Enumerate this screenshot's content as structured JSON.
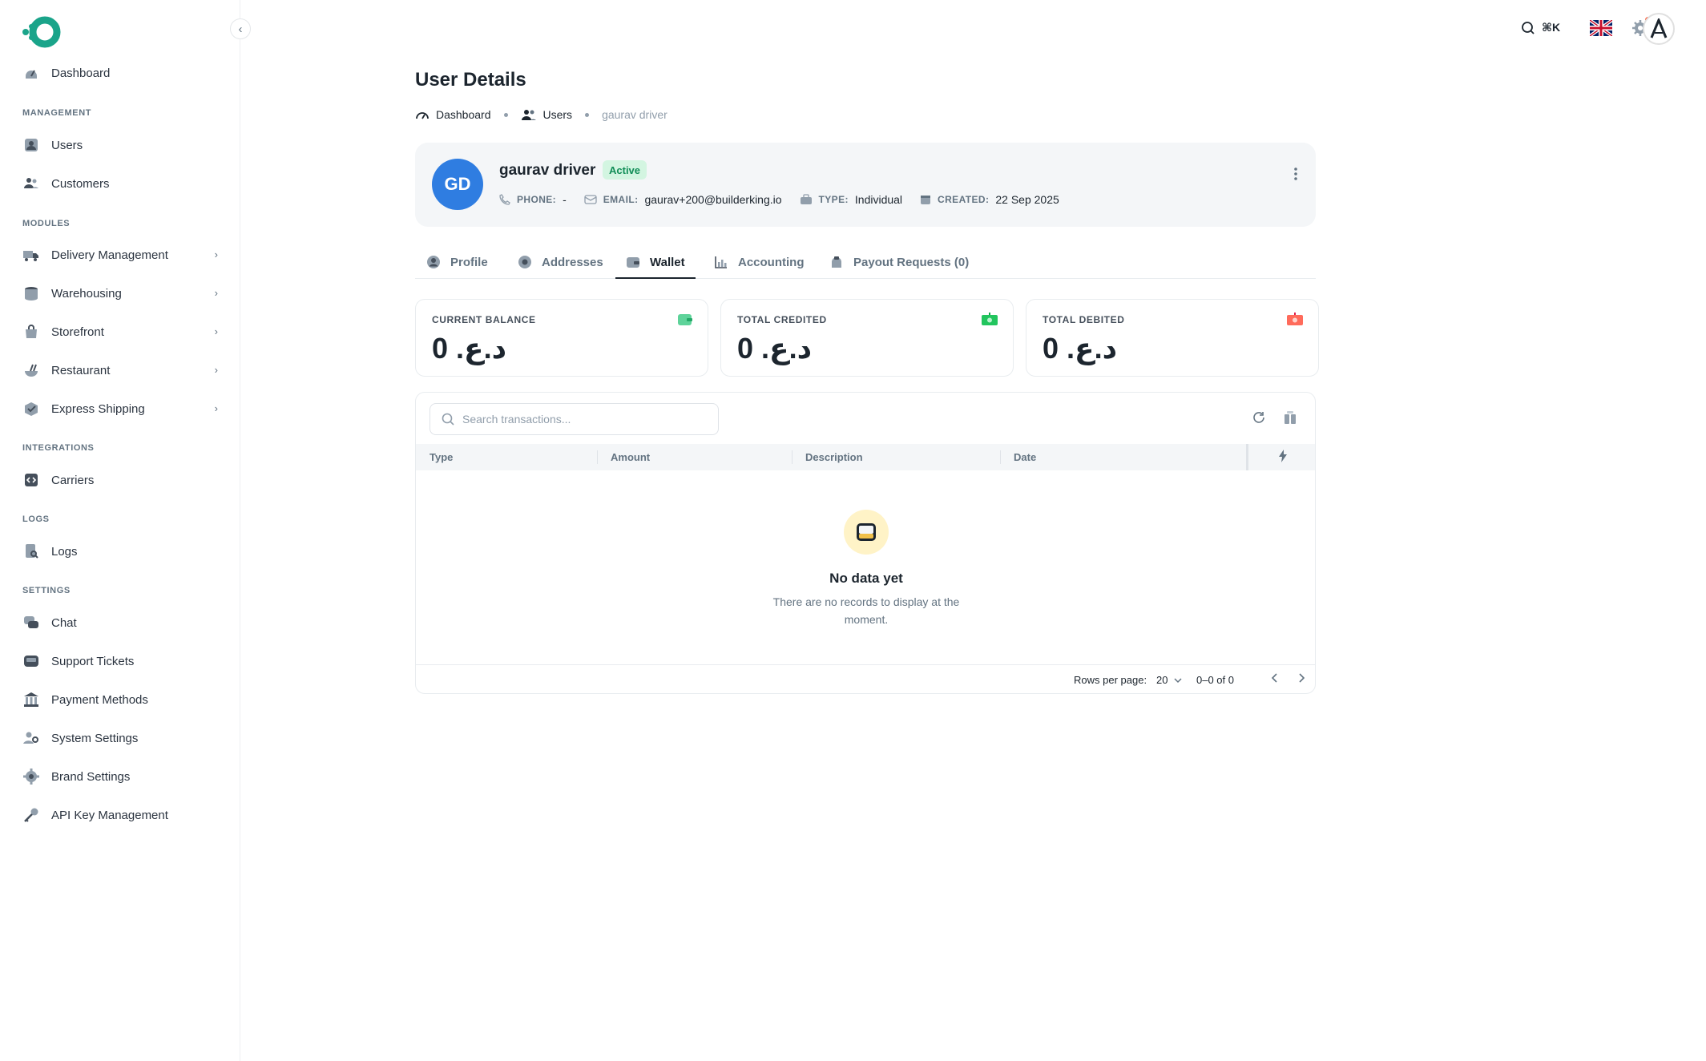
{
  "sidebar": {
    "dashboard": "Dashboard",
    "sections": {
      "management": "MANAGEMENT",
      "modules": "MODULES",
      "integrations": "INTEGRATIONS",
      "logs": "LOGS",
      "settings": "SETTINGS"
    },
    "items": {
      "users": "Users",
      "customers": "Customers",
      "delivery": "Delivery Management",
      "warehousing": "Warehousing",
      "storefront": "Storefront",
      "restaurant": "Restaurant",
      "express": "Express Shipping",
      "carriers": "Carriers",
      "logs": "Logs",
      "chat": "Chat",
      "support": "Support Tickets",
      "payment": "Payment Methods",
      "system": "System Settings",
      "brand": "Brand Settings",
      "apikey": "API Key Management"
    }
  },
  "topbar": {
    "shortcut": "⌘K",
    "accent": "#ff5630"
  },
  "page": {
    "title": "User Details",
    "breadcrumb": [
      "Dashboard",
      "Users",
      "gaurav driver"
    ]
  },
  "user": {
    "initials": "GD",
    "name": "gaurav driver",
    "status": "Active",
    "phone_label": "PHONE:",
    "phone": "-",
    "email_label": "EMAIL:",
    "email": "gaurav+200@builderking.io",
    "type_label": "TYPE:",
    "type": "Individual",
    "created_label": "CREATED:",
    "created": "22 Sep 2025",
    "avatar_color": "#2f7de1"
  },
  "tabs": [
    "Profile",
    "Addresses",
    "Wallet",
    "Accounting",
    "Payout Requests (0)"
  ],
  "stats": [
    {
      "label": "CURRENT BALANCE",
      "value": "د.ع.‏ 0"
    },
    {
      "label": "TOTAL CREDITED",
      "value": "د.ع.‏ 0"
    },
    {
      "label": "TOTAL DEBITED",
      "value": "د.ع.‏ 0"
    }
  ],
  "table": {
    "search_placeholder": "Search transactions...",
    "columns": [
      "Type",
      "Amount",
      "Description",
      "Date"
    ],
    "empty_title": "No data yet",
    "empty_desc": "There are no records to display at the moment.",
    "rows_per_page_label": "Rows per page:",
    "rows_per_page": "20",
    "range": "0–0 of 0"
  }
}
